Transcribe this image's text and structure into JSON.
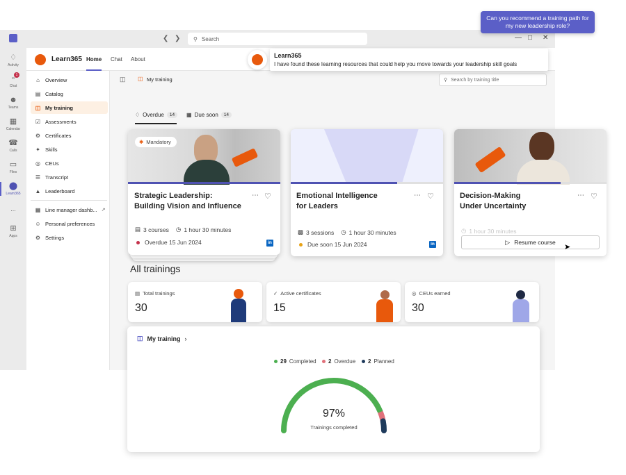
{
  "copilot": {
    "prompt": "Can you recommend a training path for my new leadership role?",
    "reply_title": "Learn365",
    "reply_message": "I have found these learning resources that could help you move towards your leadership skill goals"
  },
  "titlebar": {
    "search_placeholder": "Search",
    "back_icon": "chevron-left-icon",
    "forward_icon": "chevron-right-icon"
  },
  "rail": {
    "items": [
      {
        "label": "Activity",
        "icon": "bell-icon"
      },
      {
        "label": "Chat",
        "icon": "chat-icon",
        "badge": "1"
      },
      {
        "label": "Teams",
        "icon": "teams-icon"
      },
      {
        "label": "Calendar",
        "icon": "calendar-icon"
      },
      {
        "label": "Calls",
        "icon": "phone-icon"
      },
      {
        "label": "Files",
        "icon": "file-icon"
      },
      {
        "label": "Learn365",
        "icon": "learn365-icon",
        "active": true
      },
      {
        "label": "...",
        "icon": "more-icon"
      },
      {
        "label": "Apps",
        "icon": "plus-square-icon"
      }
    ]
  },
  "app": {
    "name": "Learn365",
    "tabs": [
      "Home",
      "Chat",
      "About"
    ],
    "active_tab": "Home",
    "brand_color": "#e8590c"
  },
  "sidebar": {
    "items": [
      {
        "label": "Overview",
        "icon": "home-icon"
      },
      {
        "label": "Catalog",
        "icon": "book-icon"
      },
      {
        "label": "My training",
        "icon": "open-book-icon",
        "active": true
      },
      {
        "label": "Assessments",
        "icon": "checklist-icon"
      },
      {
        "label": "Certificates",
        "icon": "certificate-icon"
      },
      {
        "label": "Skills",
        "icon": "skills-icon"
      },
      {
        "label": "CEUs",
        "icon": "ceu-icon"
      },
      {
        "label": "Transcript",
        "icon": "transcript-icon"
      },
      {
        "label": "Leaderboard",
        "icon": "leaderboard-icon"
      }
    ],
    "secondary": [
      {
        "label": "Line manager dashb...",
        "icon": "dashboard-icon"
      },
      {
        "label": "Personal preferences",
        "icon": "person-icon"
      },
      {
        "label": "Settings",
        "icon": "gear-icon"
      }
    ]
  },
  "content": {
    "breadcrumb": "My training",
    "search_placeholder": "Search by training title",
    "filters": [
      {
        "label": "Overdue",
        "count": "14",
        "icon": "bell-icon"
      },
      {
        "label": "Due soon",
        "count": "14",
        "icon": "calendar-icon"
      }
    ]
  },
  "courses": [
    {
      "tag": "Mandatory",
      "title_line1": "Strategic Leadership:",
      "title_line2": "Building Vision and Influence",
      "count": "3 courses",
      "duration": "1 hour 30 minutes",
      "status": "Overdue 15 Jun 2024",
      "status_color": "#c4314b",
      "progress": 1.0
    },
    {
      "title_line1": "Emotional Intelligence",
      "title_line2": "for Leaders",
      "count": "3 sessions",
      "duration": "1 hour 30 minutes",
      "status": "Due soon 15 Jun 2024",
      "status_color": "#e8a317",
      "progress": 0.7
    },
    {
      "title_line1": "Decision-Making",
      "title_line2": "Under Uncertainty",
      "duration": "1 hour 30 minutes",
      "action": "Resume course",
      "progress": 0.7
    }
  ],
  "all_trainings": {
    "title": "All trainings",
    "stats": [
      {
        "label": "Total trainings",
        "value": "30",
        "icon": "book-icon"
      },
      {
        "label": "Active certificates",
        "value": "15",
        "icon": "check-circle-icon"
      },
      {
        "label": "CEUs earned",
        "value": "30",
        "icon": "ceu-icon"
      }
    ]
  },
  "my_training_card": {
    "title": "My training",
    "legend": [
      {
        "count": "29",
        "label": "Completed",
        "color": "#4caf50"
      },
      {
        "count": "2",
        "label": "Overdue",
        "color": "#e0707a"
      },
      {
        "count": "2",
        "label": "Planned",
        "color": "#1f3b5c"
      }
    ],
    "percent": "97%",
    "caption": "Trainings completed"
  }
}
